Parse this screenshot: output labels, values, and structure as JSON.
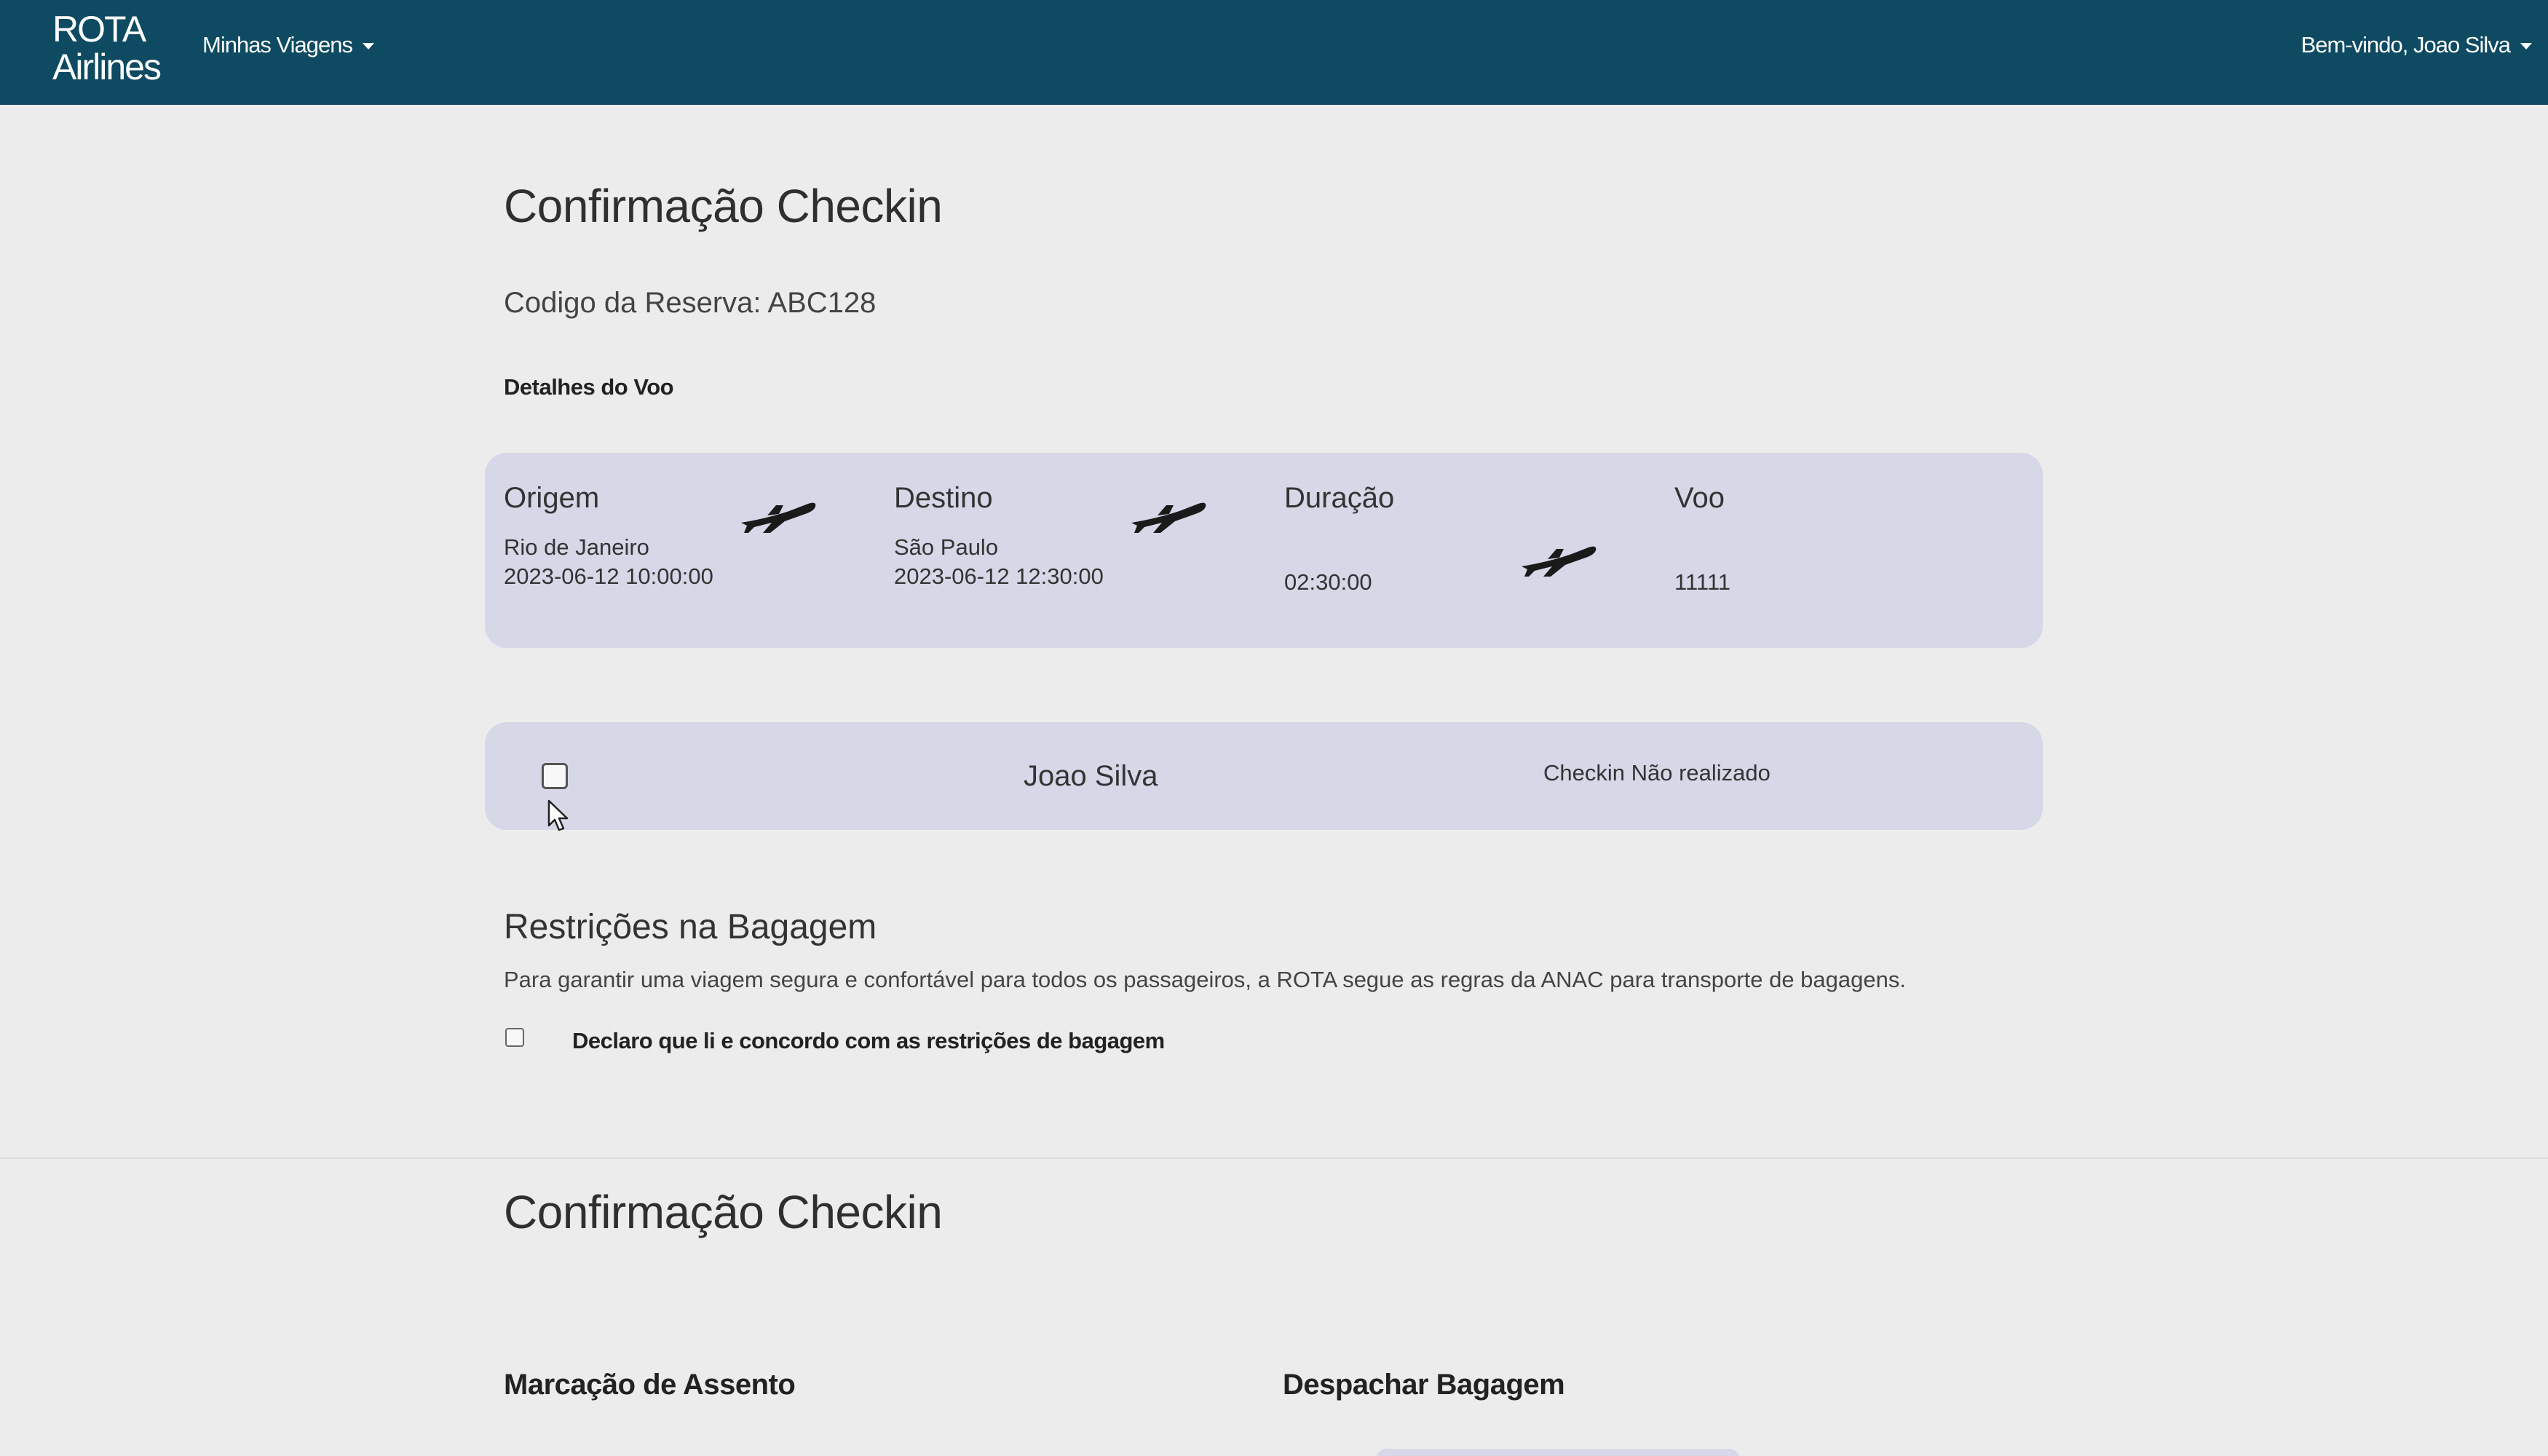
{
  "navbar": {
    "brand_line1": "ROTA",
    "brand_line2": "Airlines",
    "menu_label": "Minhas Viagens",
    "user_label": "Bem-vindo, Joao Silva",
    "bg_color": "#0e4a62"
  },
  "checkin": {
    "title": "Confirmação Checkin",
    "reservation": "Codigo da Reserva: ABC128",
    "details_heading": "Detalhes do Voo"
  },
  "flight": {
    "origin_label": "Origem",
    "origin_city": "Rio de Janeiro",
    "origin_datetime": "2023-06-12 10:00:00",
    "destination_label": "Destino",
    "destination_city": "São Paulo",
    "destination_datetime": "2023-06-12 12:30:00",
    "duration_label": "Duração",
    "duration_value": "02:30:00",
    "flight_label": "Voo",
    "flight_number": "11111",
    "icon": "airplane-icon"
  },
  "passenger": {
    "name": "Joao Silva",
    "status": "Checkin Não realizado",
    "checked": false
  },
  "baggage": {
    "title": "Restrições na Bagagem",
    "description": "Para garantir uma viagem segura e confortável para todos os passageiros, a ROTA segue as regras da ANAC para transporte de bagagens.",
    "agree_label": "Declaro que li e concordo com as restrições de bagagem",
    "agreed": false
  },
  "section2": {
    "title": "Confirmação Checkin",
    "seat_heading": "Marcação de Assento",
    "baggage_heading": "Despachar Bagagem"
  }
}
